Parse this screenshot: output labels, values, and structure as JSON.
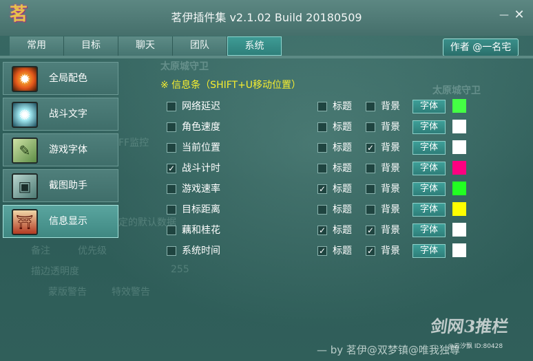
{
  "app": {
    "logo_text": "茗",
    "title": "茗伊插件集 v2.1.02 Build 20180509"
  },
  "window_controls": {
    "minimize": "—",
    "close": "✕"
  },
  "tabs": [
    {
      "label": "常用"
    },
    {
      "label": "目标"
    },
    {
      "label": "聊天"
    },
    {
      "label": "团队"
    },
    {
      "label": "系统",
      "active": true
    }
  ],
  "author_button": "作者 @一名宅",
  "menu": [
    {
      "label": "全局配色",
      "icon": "palette-icon"
    },
    {
      "label": "战斗文字",
      "icon": "burst-icon"
    },
    {
      "label": "游戏字体",
      "icon": "brush-icon"
    },
    {
      "label": "截图助手",
      "icon": "camera-icon"
    },
    {
      "label": "信息显示",
      "icon": "pavilion-icon",
      "active": true
    }
  ],
  "section": {
    "title": "※ 信息条（SHIFT+U移动位置）"
  },
  "info_rows": [
    {
      "label": "网络延迟",
      "enabled": false,
      "title_label": "标题",
      "title_on": false,
      "bg_label": "背景",
      "bg_on": false,
      "font_btn": "字体",
      "color": "#44ff44"
    },
    {
      "label": "角色速度",
      "enabled": false,
      "title_label": "标题",
      "title_on": false,
      "bg_label": "背景",
      "bg_on": false,
      "font_btn": "字体",
      "color": "#ffffff"
    },
    {
      "label": "当前位置",
      "enabled": false,
      "title_label": "标题",
      "title_on": false,
      "bg_label": "背景",
      "bg_on": true,
      "font_btn": "字体",
      "color": "#ffffff"
    },
    {
      "label": "战斗计时",
      "enabled": true,
      "title_label": "标题",
      "title_on": false,
      "bg_label": "背景",
      "bg_on": false,
      "font_btn": "字体",
      "color": "#ff0080"
    },
    {
      "label": "游戏速率",
      "enabled": false,
      "title_label": "标题",
      "title_on": true,
      "bg_label": "背景",
      "bg_on": false,
      "font_btn": "字体",
      "color": "#22ff22"
    },
    {
      "label": "目标距离",
      "enabled": false,
      "title_label": "标题",
      "title_on": false,
      "bg_label": "背景",
      "bg_on": false,
      "font_btn": "字体",
      "color": "#ffff00"
    },
    {
      "label": "藕和桂花",
      "enabled": false,
      "title_label": "标题",
      "title_on": true,
      "bg_label": "背景",
      "bg_on": true,
      "font_btn": "字体",
      "color": "#ffffff"
    },
    {
      "label": "系统时间",
      "enabled": false,
      "title_label": "标题",
      "title_on": true,
      "bg_label": "背景",
      "bg_on": true,
      "font_btn": "字体",
      "color": "#ffffff"
    }
  ],
  "ghost": {
    "npc1": "太原城守卫",
    "npc2": "太原城守卫",
    "buff": "FF监控",
    "default_data": "定的默认数据",
    "note": "备注",
    "priority": "优先级",
    "opacity_label": "描边透明度",
    "opacity_value": "255",
    "warn1": "蒙版警告",
    "warn2": "特效警告"
  },
  "footer": "— by 茗伊@双梦镇@唯我独尊",
  "watermark": {
    "line1": "剑网3推栏",
    "line2": "@云汐飘 ID:80428"
  }
}
